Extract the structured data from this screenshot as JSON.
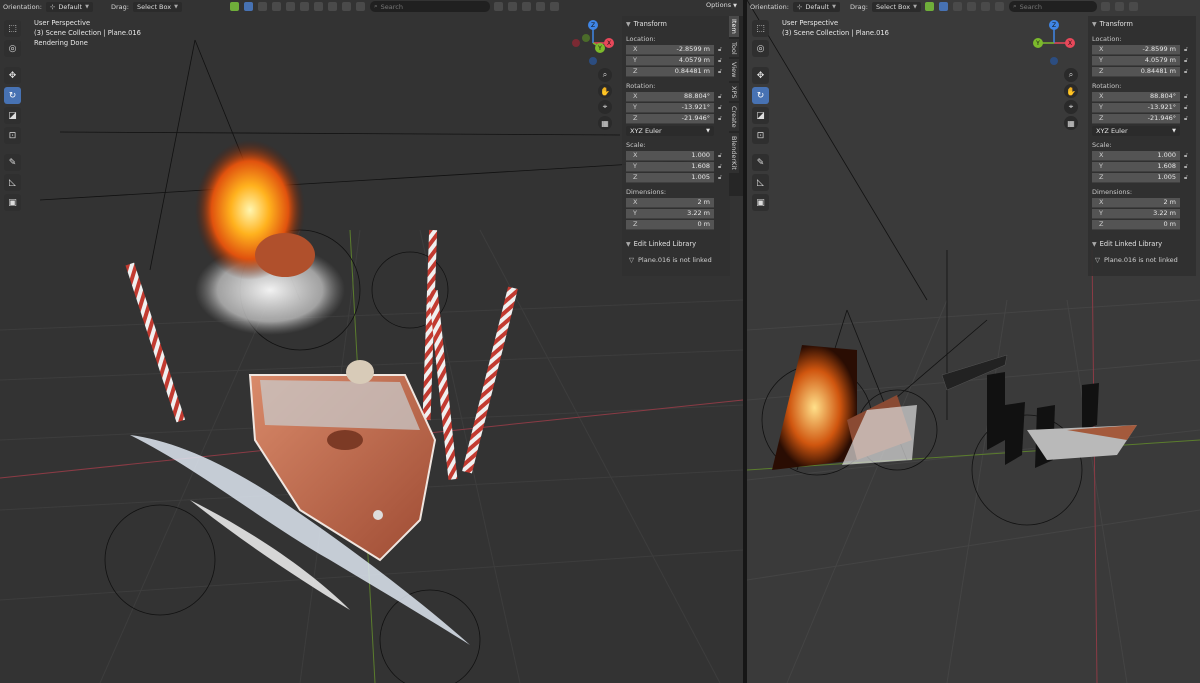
{
  "header": {
    "orientation_label": "Orientation:",
    "orientation_value": "Default",
    "drag_label": "Drag:",
    "drag_value": "Select Box",
    "search_placeholder": "Search",
    "options_label": "Options"
  },
  "overlay": {
    "view_name": "User Perspective",
    "collection_path": "(3) Scene Collection | Plane.016",
    "status": "Rendering Done"
  },
  "side_tabs": [
    "Item",
    "Tool",
    "View",
    "XPS",
    "Create",
    "BlenderKit"
  ],
  "transform_panel": {
    "title": "Transform",
    "location_label": "Location:",
    "location": [
      {
        "axis": "X",
        "value": "-2.8599 m"
      },
      {
        "axis": "Y",
        "value": "4.0579 m"
      },
      {
        "axis": "Z",
        "value": "0.84481 m"
      }
    ],
    "rotation_label": "Rotation:",
    "rotation": [
      {
        "axis": "X",
        "value": "88.804°"
      },
      {
        "axis": "Y",
        "value": "-13.921°"
      },
      {
        "axis": "Z",
        "value": "-21.946°"
      }
    ],
    "rotation_mode": "XYZ Euler",
    "scale_label": "Scale:",
    "scale": [
      {
        "axis": "X",
        "value": "1.000"
      },
      {
        "axis": "Y",
        "value": "1.608"
      },
      {
        "axis": "Z",
        "value": "1.005"
      }
    ],
    "dimensions_label": "Dimensions:",
    "dimensions": [
      {
        "axis": "X",
        "value": "2 m"
      },
      {
        "axis": "Y",
        "value": "3.22 m"
      },
      {
        "axis": "Z",
        "value": "0 m"
      }
    ]
  },
  "library_panel": {
    "title": "Edit Linked Library",
    "message": "Plane.016 is not linked"
  },
  "gizmo": {
    "x": "X",
    "y": "Y",
    "z": "Z"
  },
  "colors": {
    "accent": "#4772b3",
    "axis_x": "#e8485a",
    "axis_y": "#7cba2c",
    "axis_z": "#3f86e6"
  }
}
